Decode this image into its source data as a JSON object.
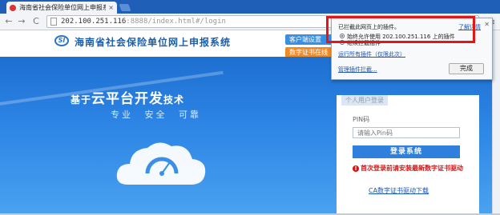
{
  "browser": {
    "tab_title": "海南省社会保险单位网上申报系",
    "tab_close": "×",
    "url_host": "202.100.251.116",
    "url_rest": ":8888/index.html#/login",
    "back": "←",
    "forward": "→",
    "reload": "C",
    "menu": "≡",
    "star": "☆",
    "plugin_blocked": "✕"
  },
  "header": {
    "logo_text": "SI",
    "site_title": "海南省社会保险单位网上申报系统",
    "btn_setup": "客户端设置",
    "btn_cert": "数字证书在线"
  },
  "banner": {
    "slogan_prefix": "基于",
    "slogan_main": "云平台开发",
    "slogan_suffix": "技术",
    "subslogan": "专业 安全 可靠"
  },
  "login": {
    "tab_label": "个人用户登录",
    "pin_label": "PIN码",
    "pin_placeholder": "请输入Pin码",
    "submit": "登录系统",
    "warning": "首次登录前请安装最新数字证书驱动",
    "driver_link": "CA数字证书驱动下载"
  },
  "popup": {
    "title": "已拦截此网页上的插件。",
    "learn_more": "了解详情",
    "option_allow": "始终允许使用 202.100.251.116 上的插件",
    "option_block": "继续拦截插件",
    "run_all": "运行所有插件（仅限此次）",
    "manage": "管理插件拦截...",
    "done": "完成",
    "close": "✕"
  },
  "colors": {
    "chrome_blue": "#1f5fb7",
    "banner_blue": "#2e86e6",
    "login_button": "#2f7fdc",
    "warning_red": "#dd1111",
    "highlight_red": "#e21616",
    "orange_button": "#f08a24"
  }
}
